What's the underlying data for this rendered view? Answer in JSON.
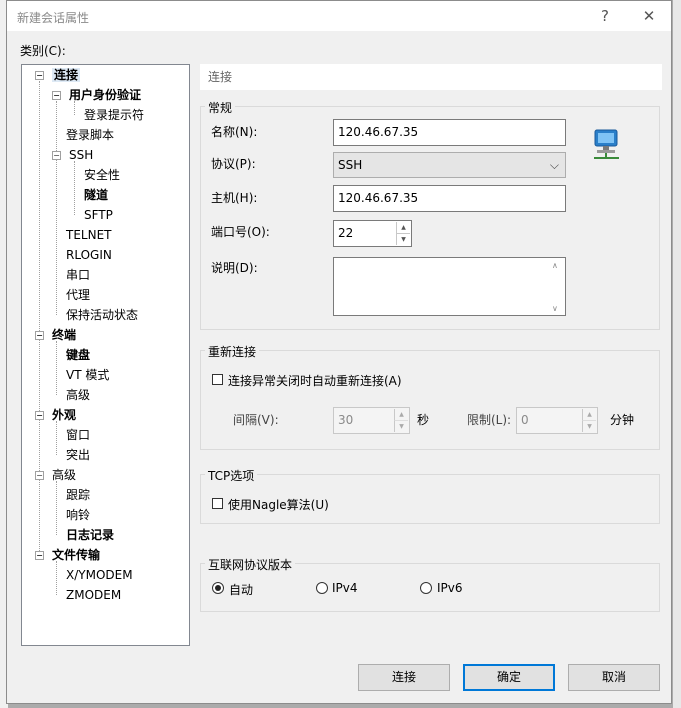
{
  "window": {
    "title": "新建会话属性",
    "help_label": "?",
    "close_label": "✕"
  },
  "category_label": "类别(C):",
  "tree": [
    {
      "label": "连接",
      "bold": true
    },
    {
      "label": "用户身份验证",
      "bold": true
    },
    {
      "label": "登录提示符",
      "bold": false
    },
    {
      "label": "登录脚本",
      "bold": false
    },
    {
      "label": "SSH",
      "bold": false
    },
    {
      "label": "安全性",
      "bold": false
    },
    {
      "label": "隧道",
      "bold": true
    },
    {
      "label": "SFTP",
      "bold": false
    },
    {
      "label": "TELNET",
      "bold": false
    },
    {
      "label": "RLOGIN",
      "bold": false
    },
    {
      "label": "串口",
      "bold": false
    },
    {
      "label": "代理",
      "bold": false
    },
    {
      "label": "保持活动状态",
      "bold": false
    },
    {
      "label": "终端",
      "bold": true
    },
    {
      "label": "键盘",
      "bold": true
    },
    {
      "label": "VT 模式",
      "bold": false
    },
    {
      "label": "高级",
      "bold": false
    },
    {
      "label": "外观",
      "bold": true
    },
    {
      "label": "窗口",
      "bold": false
    },
    {
      "label": "突出",
      "bold": false
    },
    {
      "label": "高级",
      "bold": false
    },
    {
      "label": "跟踪",
      "bold": false
    },
    {
      "label": "响铃",
      "bold": false
    },
    {
      "label": "日志记录",
      "bold": true
    },
    {
      "label": "文件传输",
      "bold": true
    },
    {
      "label": "X/YMODEM",
      "bold": false
    },
    {
      "label": "ZMODEM",
      "bold": false
    }
  ],
  "header": "连接",
  "general": {
    "title": "常规",
    "name_label": "名称(N):",
    "name_value": "120.46.67.35",
    "protocol_label": "协议(P):",
    "protocol_value": "SSH",
    "host_label": "主机(H):",
    "host_value": "120.46.67.35",
    "port_label": "端口号(O):",
    "port_value": "22",
    "desc_label": "说明(D):",
    "desc_value": ""
  },
  "reconnect": {
    "title": "重新连接",
    "checkbox_label": "连接异常关闭时自动重新连接(A)",
    "interval_label": "间隔(V):",
    "interval_value": "30",
    "interval_unit": "秒",
    "limit_label": "限制(L):",
    "limit_value": "0",
    "limit_unit": "分钟"
  },
  "tcp": {
    "title": "TCP选项",
    "checkbox_label": "使用Nagle算法(U)"
  },
  "ip": {
    "title": "互联网协议版本",
    "options": [
      "自动",
      "IPv4",
      "IPv6"
    ],
    "selected": "自动"
  },
  "buttons": {
    "connect": "连接",
    "ok": "确定",
    "cancel": "取消"
  },
  "colors": {
    "accent": "#0078d7",
    "selection": "#dde9f5",
    "panel": "#f0f0f0"
  }
}
